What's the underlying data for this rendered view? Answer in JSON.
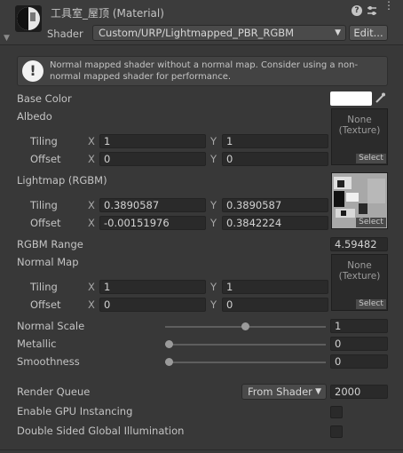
{
  "header": {
    "title": "工具室_屋顶 (Material)",
    "shader_label": "Shader",
    "shader_value": "Custom/URP/Lightmapped_PBR_RGBM",
    "edit_label": "Edit...",
    "icons": [
      "help-icon",
      "settings-sliders-icon",
      "more-options-icon"
    ]
  },
  "warning": {
    "text": "Normal mapped shader without a normal map. Consider using a non-normal mapped shader for performance."
  },
  "properties": {
    "base_color_label": "Base Color",
    "base_color_value": "#ffffff",
    "albedo_label": "Albedo",
    "albedo_texture": "None\n(Texture)",
    "albedo_tiling": {
      "label": "Tiling",
      "x": "1",
      "y": "1"
    },
    "albedo_offset": {
      "label": "Offset",
      "x": "0",
      "y": "0"
    },
    "lightmap_label": "Lightmap (RGBM)",
    "lightmap_tiling": {
      "label": "Tiling",
      "x": "0.3890587",
      "y": "0.3890587"
    },
    "lightmap_offset": {
      "label": "Offset",
      "x": "-0.00151976",
      "y": "0.3842224"
    },
    "rgbm_label": "RGBM Range",
    "rgbm_value": "4.59482",
    "normal_label": "Normal Map",
    "normal_texture": "None\n(Texture)",
    "normal_tiling": {
      "label": "Tiling",
      "x": "1",
      "y": "1"
    },
    "normal_offset": {
      "label": "Offset",
      "x": "0",
      "y": "0"
    },
    "select_label": "Select",
    "x_label": "X",
    "y_label": "Y",
    "normal_scale": {
      "label": "Normal Scale",
      "value": "1",
      "fraction": 0.5
    },
    "metallic": {
      "label": "Metallic",
      "value": "0",
      "fraction": 0
    },
    "smoothness": {
      "label": "Smoothness",
      "value": "0",
      "fraction": 0
    }
  },
  "advanced": {
    "render_queue_label": "Render Queue",
    "render_queue_mode": "From Shader",
    "render_queue_value": "2000",
    "gpu_instancing_label": "Enable GPU Instancing",
    "gpu_instancing_checked": false,
    "double_sided_gi_label": "Double Sided Global Illumination",
    "double_sided_gi_checked": false
  },
  "colors": {
    "background": "#383838",
    "field": "#2a2a2a",
    "accent": "#ffffff"
  }
}
